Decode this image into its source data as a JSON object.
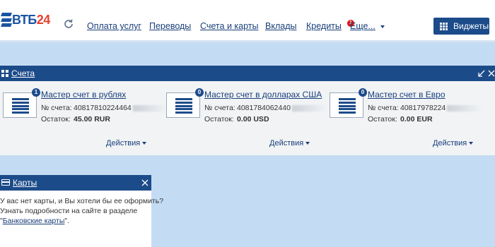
{
  "brand": {
    "name": "ВТБ",
    "number": "24"
  },
  "nav": {
    "items": [
      "Оплата услуг",
      "Переводы",
      "Счета и карты",
      "Вклады",
      "Кредиты"
    ],
    "more_label": "Еще...",
    "notification_count": "1"
  },
  "widgets_button": {
    "label": "Виджеты"
  },
  "accounts_panel": {
    "title": "Счета",
    "accounts": [
      {
        "badge": "1",
        "name": "Мастер счет в рублях",
        "number_label": "№ счета:",
        "number": "40817810224464",
        "balance_label": "Остаток:",
        "balance": "45.00 RUR",
        "actions": "Действия"
      },
      {
        "badge": "0",
        "name": "Мастер счет в долларах США",
        "number_label": "№ счета:",
        "number": "4081784062440",
        "balance_label": "Остаток:",
        "balance": "0.00 USD",
        "actions": "Действия"
      },
      {
        "badge": "0",
        "name": "Мастер счет в Евро",
        "number_label": "№ счета:",
        "number": "40817978224",
        "balance_label": "Остаток:",
        "balance": "0.00 EUR",
        "actions": "Действия"
      }
    ]
  },
  "cards_panel": {
    "title": "Карты",
    "line1": "У вас нет карты, и Вы хотели бы ее оформить?",
    "line2": "Узнать подробности на сайте в разделе",
    "link_open": "\"",
    "link_text": "Банковские карты",
    "link_close": "\"."
  },
  "colors": {
    "header_blue": "#1c4b8a",
    "link_blue": "#1a3f7a",
    "brand_red": "#e9412f",
    "page_bg": "#c4dcf3"
  },
  "icons": [
    "refresh-icon",
    "widgets-grid-icon",
    "accounts-icon",
    "card-icon",
    "collapse-icon",
    "close-icon",
    "account-stack-icon"
  ]
}
